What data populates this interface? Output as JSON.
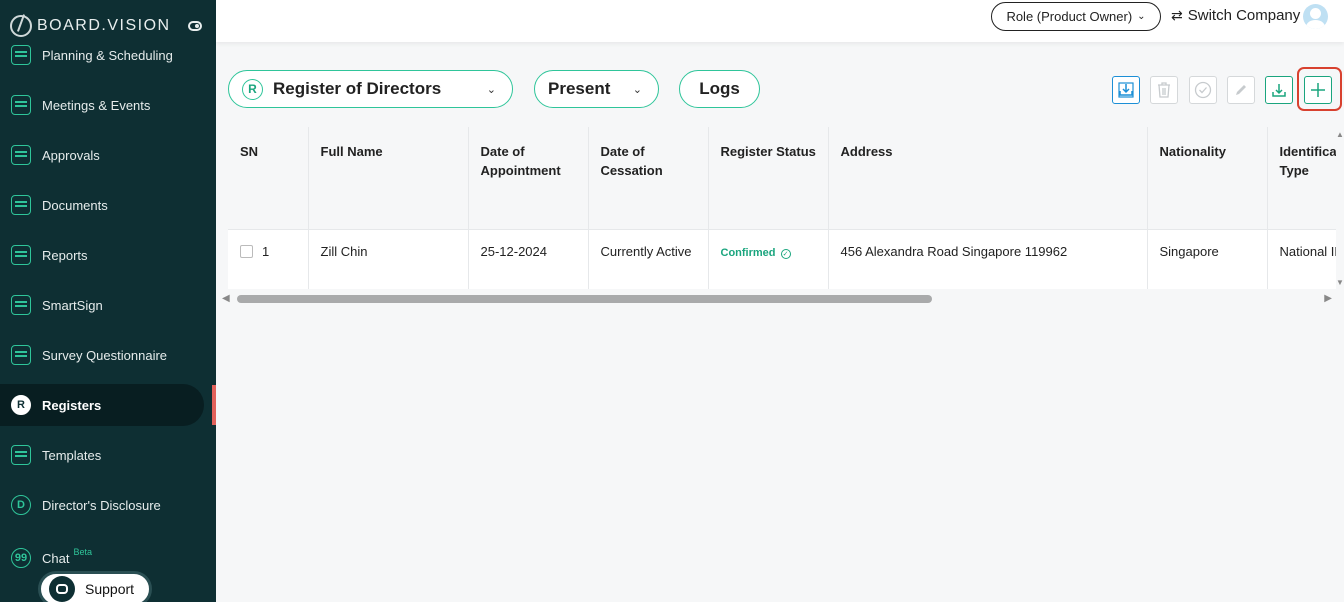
{
  "sidebar": {
    "brand": "BOARD.VISION",
    "items": [
      {
        "label": "Planning & Scheduling",
        "icon": "calendar-grid-icon"
      },
      {
        "label": "Meetings & Events",
        "icon": "calendar-icon"
      },
      {
        "label": "Approvals",
        "icon": "approvals-icon"
      },
      {
        "label": "Documents",
        "icon": "documents-icon"
      },
      {
        "label": "Reports",
        "icon": "reports-icon"
      },
      {
        "label": "SmartSign",
        "icon": "pen-icon"
      },
      {
        "label": "Survey Questionnaire",
        "icon": "survey-icon"
      },
      {
        "label": "Registers",
        "icon": "registers-icon",
        "glyph": "R"
      },
      {
        "label": "Templates",
        "icon": "templates-icon"
      },
      {
        "label": "Director's Disclosure",
        "icon": "disclosure-icon",
        "glyph": "D"
      },
      {
        "label": "Chat",
        "icon": "chat-icon",
        "badge": "Beta"
      }
    ],
    "support": "Support"
  },
  "header": {
    "role": "Role (Product Owner)",
    "switch_company": "Switch Company"
  },
  "filters": {
    "register": "Register of Directors",
    "register_glyph": "R",
    "period": "Present",
    "logs": "Logs"
  },
  "toolbar": {
    "icons": [
      "import-icon",
      "delete-icon",
      "approve-icon",
      "edit-icon",
      "download-icon",
      "add-icon"
    ]
  },
  "table": {
    "columns": [
      "SN",
      "Full Name",
      "Date of Appointment",
      "Date of Cessation",
      "Register Status",
      "Address",
      "Nationality",
      "Identification Type"
    ],
    "rows": [
      {
        "sn": "1",
        "full_name": "Zill Chin",
        "date_of_appointment": "25-12-2024",
        "date_of_cessation": "Currently Active",
        "register_status": "Confirmed",
        "address": "456 Alexandra Road Singapore 119962",
        "nationality": "Singapore",
        "identification_type": "National ID"
      }
    ]
  },
  "colors": {
    "sidebar_bg": "#0e2f33",
    "accent": "#2fc59a",
    "status_confirmed": "#1aa57e",
    "highlight": "#d8412f"
  }
}
